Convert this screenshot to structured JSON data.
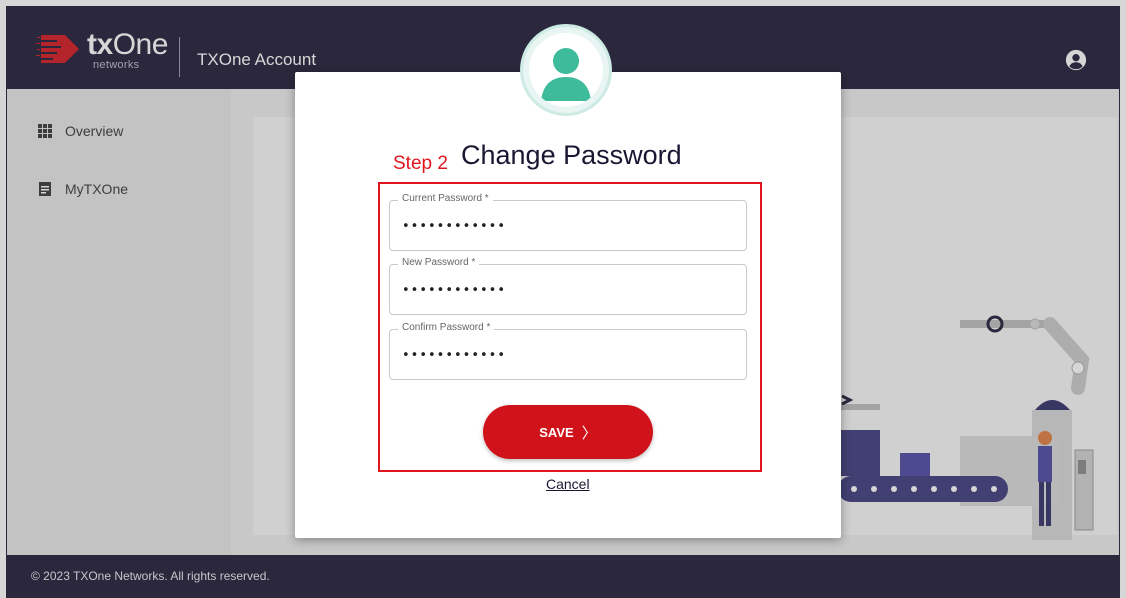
{
  "header": {
    "logo_word_prefix": "tx",
    "logo_word_suffix": "One",
    "logo_sub": "networks",
    "app_title": "TXOne Account"
  },
  "sidebar": {
    "items": [
      {
        "label": "Overview",
        "icon": "grid-icon"
      },
      {
        "label": "MyTXOne",
        "icon": "document-icon"
      }
    ]
  },
  "modal": {
    "step_label": "Step 2",
    "title": "Change Password",
    "fields": [
      {
        "label": "Current Password *",
        "value": "••••••••••••"
      },
      {
        "label": "New Password *",
        "value": "••••••••••••"
      },
      {
        "label": "Confirm Password *",
        "value": "••••••••••••"
      }
    ],
    "save_label": "SAVE",
    "save_chevron": "〉",
    "cancel_label": "Cancel"
  },
  "footer": {
    "text": "© 2023 TXOne Networks. All rights reserved."
  },
  "colors": {
    "header_bg": "#1b1733",
    "accent_red": "#d0121b",
    "avatar_green": "#3dbb9a"
  }
}
